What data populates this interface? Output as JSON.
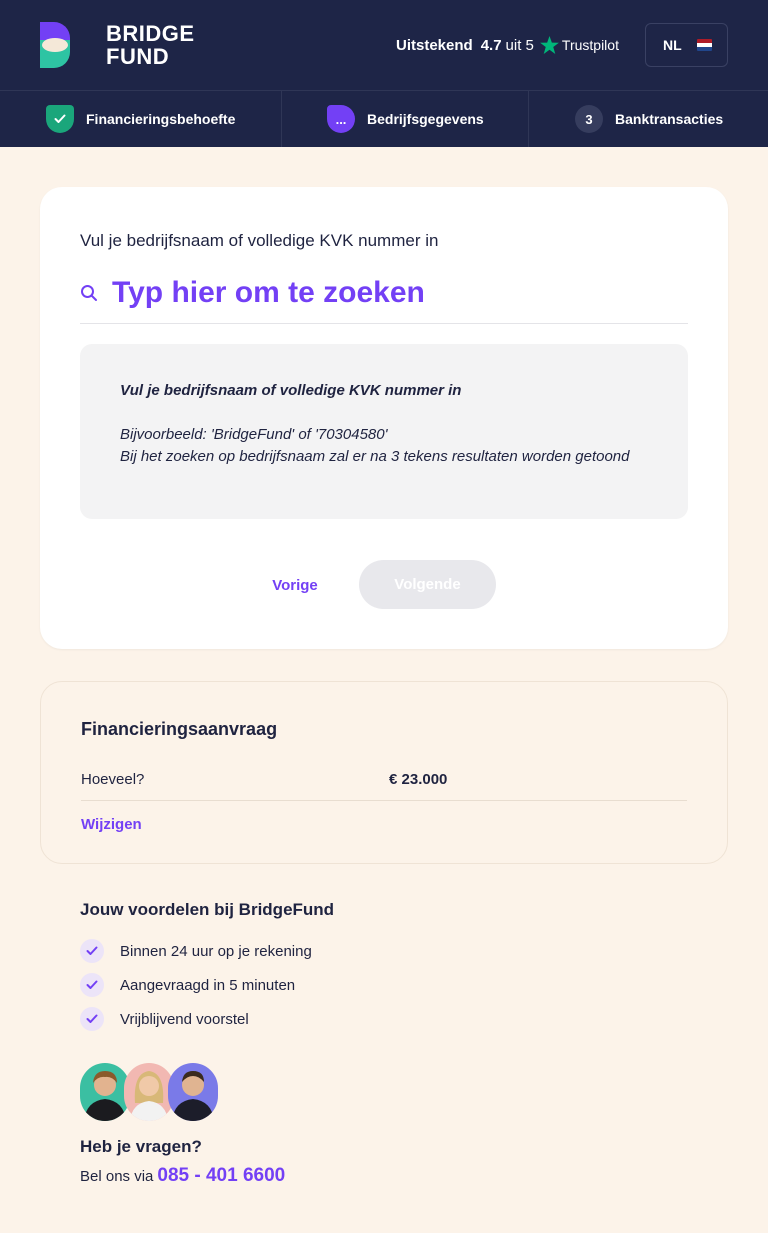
{
  "header": {
    "logo": {
      "line1": "BRIDGE",
      "line2": "FUND"
    },
    "rating": {
      "word": "Uitstekend",
      "score": "4.7",
      "of": "uit 5",
      "brand": "Trustpilot"
    },
    "language": "NL"
  },
  "steps": [
    {
      "label": "Financieringsbehoefte",
      "status": "done"
    },
    {
      "label": "Bedrijfsgegevens",
      "badge": "...",
      "status": "current"
    },
    {
      "label": "Banktransacties",
      "badge": "3",
      "status": "upcoming"
    }
  ],
  "search": {
    "prompt": "Vul je bedrijfsnaam of volledige KVK nummer in",
    "placeholder": "Typ hier om te zoeken",
    "value": ""
  },
  "info": {
    "title": "Vul je bedrijfsnaam of volledige KVK nummer in",
    "example": "Bijvoorbeeld: 'BridgeFund' of '70304580'",
    "note": "Bij het zoeken op bedrijfsnaam zal er na 3 tekens resultaten worden getoond"
  },
  "nav": {
    "prev": "Vorige",
    "next": "Volgende"
  },
  "summary": {
    "title": "Financieringsaanvraag",
    "amount_label": "Hoeveel?",
    "amount_value": "€ 23.000",
    "edit": "Wijzigen"
  },
  "benefits": {
    "title": "Jouw voordelen bij BridgeFund",
    "items": [
      "Binnen 24 uur op je rekening",
      "Aangevraagd in 5 minuten",
      "Vrijblijvend voorstel"
    ]
  },
  "contact": {
    "title": "Heb je vragen?",
    "text": "Bel ons via",
    "phone": "085 - 401 6600"
  },
  "colors": {
    "navy": "#1e2547",
    "accent": "#7340f5",
    "success": "#1aa67b",
    "background": "#fcf3e9"
  }
}
